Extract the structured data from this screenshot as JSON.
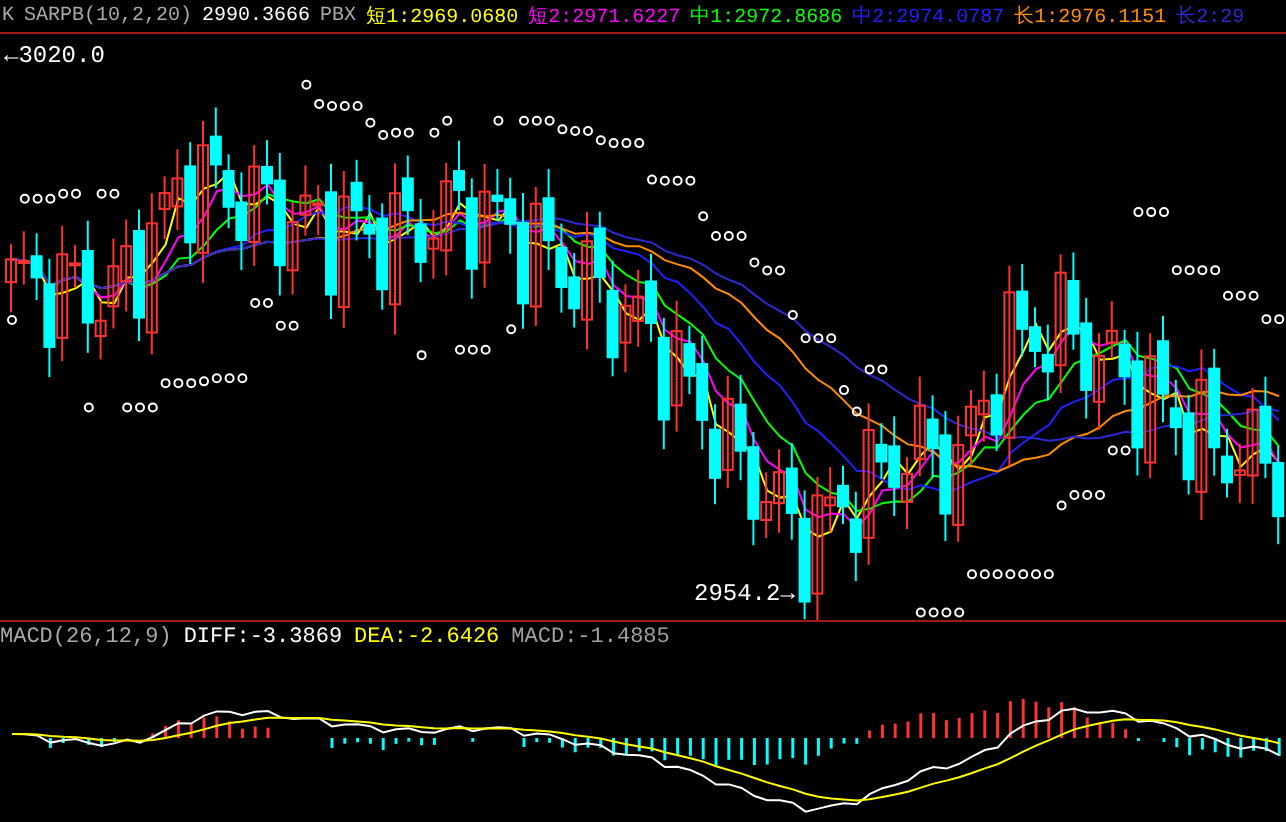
{
  "header": {
    "indicator": "K",
    "name": "SARPB(10,2,20)",
    "value": "2990.3666",
    "label": "PBX",
    "lines": [
      {
        "text": "短1:2969.0680",
        "color": "#ffff00"
      },
      {
        "text": "短2:2971.6227",
        "color": "#ff00ff"
      },
      {
        "text": "中1:2972.8686",
        "color": "#00ff00"
      },
      {
        "text": "中2:2974.0787",
        "color": "#2020ff"
      },
      {
        "text": "长1:2976.1151",
        "color": "#ff8c00"
      },
      {
        "text": "长2:29",
        "color": "#2a2ad0"
      }
    ]
  },
  "price_labels": {
    "high": "←3020.0",
    "low": "2954.2→"
  },
  "macd": {
    "name": "MACD(26,12,9)",
    "items": [
      {
        "text": "DIFF:-3.3869",
        "color": "#ffffff"
      },
      {
        "text": "DEA:-2.6426",
        "color": "#ffff00"
      },
      {
        "text": "MACD:-1.4885",
        "color": "#a0a0a0"
      }
    ]
  }
}
